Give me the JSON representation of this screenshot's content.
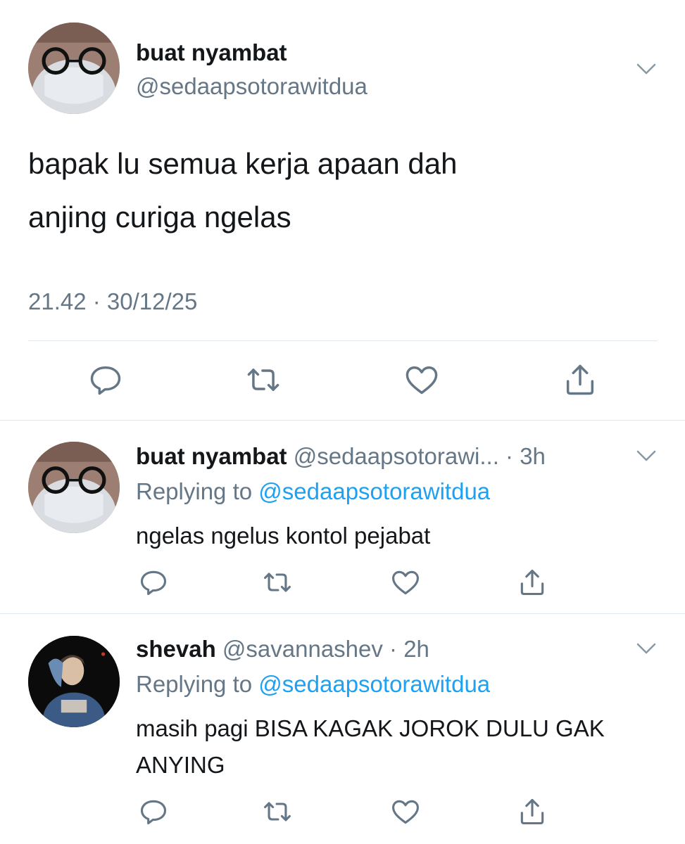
{
  "main_tweet": {
    "author_name": "buat nyambat",
    "author_handle": "@sedaapsotorawitdua",
    "text_lines": [
      "bapak lu semua kerja apaan dah",
      "anjing curiga ngelas"
    ],
    "timestamp": "21.42 · 30/12/25"
  },
  "replies": [
    {
      "author_name": "buat nyambat",
      "meta": "@sedaapsotorawi... · 3h",
      "replying_prefix": "Replying to",
      "replying_to": "@sedaapsotorawitdua",
      "text": "ngelas ngelus kontol pejabat"
    },
    {
      "author_name": "shevah",
      "meta": "@savannashev · 2h",
      "replying_prefix": "Replying to",
      "replying_to": "@sedaapsotorawitdua",
      "text": "masih pagi BISA KAGAK JOROK DULU GAK ANYING"
    }
  ],
  "icons": [
    "reply-icon",
    "retweet-icon",
    "like-icon",
    "share-icon",
    "chevron-down-icon"
  ],
  "colors": {
    "text": "#14171a",
    "secondary": "#657786",
    "link": "#1da1f2",
    "divider": "#e1e8ed"
  }
}
